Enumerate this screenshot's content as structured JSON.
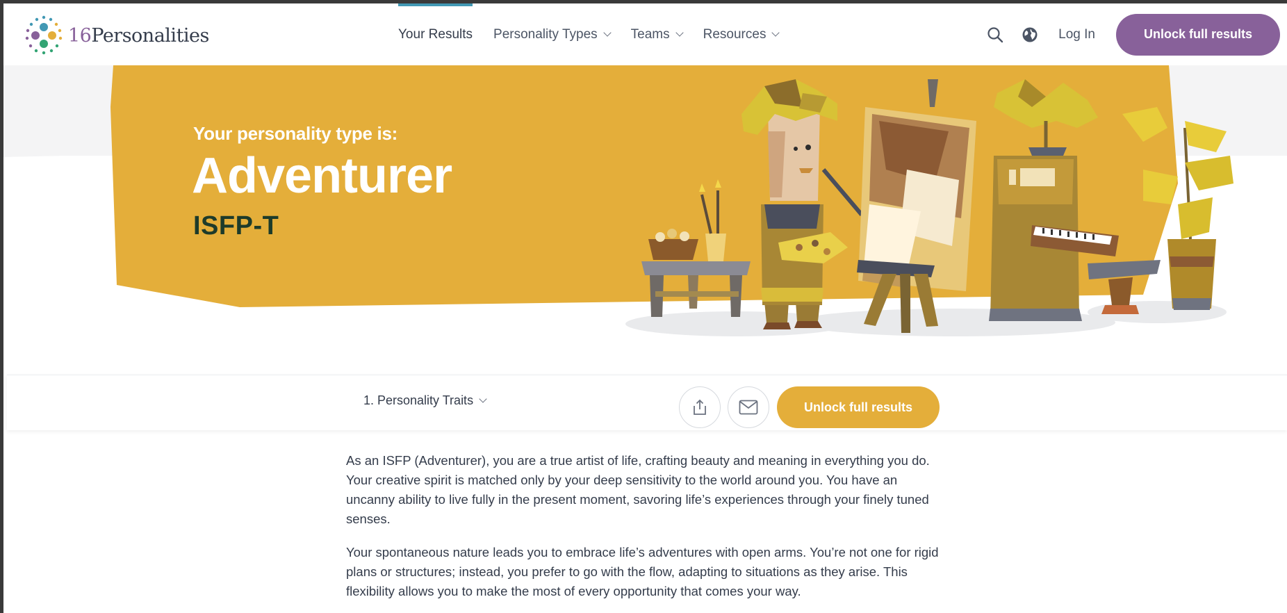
{
  "brand": {
    "logo_number": "16",
    "logo_word": "Personalities"
  },
  "nav": [
    {
      "label": "Your Results",
      "active": true,
      "dropdown": false
    },
    {
      "label": "Personality Types",
      "active": false,
      "dropdown": true
    },
    {
      "label": "Teams",
      "active": false,
      "dropdown": true
    },
    {
      "label": "Resources",
      "active": false,
      "dropdown": true
    }
  ],
  "header": {
    "login_label": "Log In",
    "unlock_label": "Unlock full results"
  },
  "hero": {
    "subtitle": "Your personality type is:",
    "type_name": "Adventurer",
    "type_code": "ISFP-T"
  },
  "toolbar": {
    "section_label": "1. Personality Traits",
    "unlock_label": "Unlock full results"
  },
  "content": {
    "paragraphs": [
      "As an ISFP (Adventurer), you are a true artist of life, crafting beauty and meaning in everything you do. Your creative spirit is matched only by your deep sensitivity to the world around you. You have an uncanny ability to live fully in the present moment, savoring life’s experiences through your finely tuned senses.",
      "Your spontaneous nature leads you to embrace life’s adventures with open arms. You’re not one for rigid plans or structures; instead, you prefer to go with the flow, adapting to situations as they arise. This flexibility allows you to make the most of every opportunity that comes your way."
    ]
  },
  "colors": {
    "brand_purple": "#88619a",
    "hero_yellow": "#e4ae3a",
    "nav_active": "#4298b4",
    "type_code_green": "#1d3b2a"
  },
  "icons": [
    "search-icon",
    "globe-icon",
    "share-icon",
    "email-icon",
    "chevron-down-icon"
  ]
}
